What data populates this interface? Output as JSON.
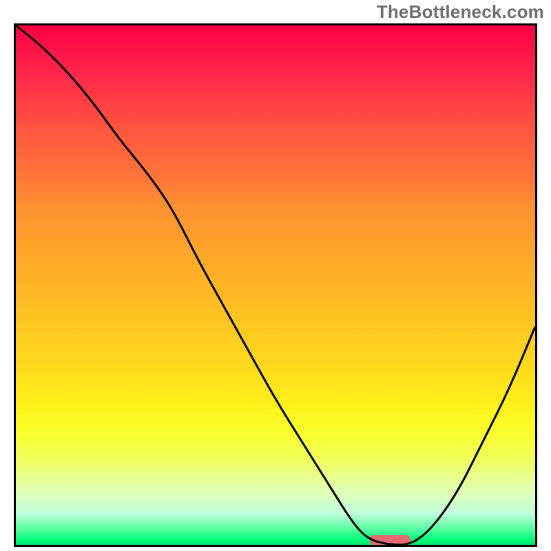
{
  "watermark": "TheBottleneck.com",
  "chart_data": {
    "type": "line",
    "title": "",
    "xlabel": "",
    "ylabel": "",
    "xlim": [
      0,
      100
    ],
    "ylim": [
      0,
      100
    ],
    "series": [
      {
        "name": "curve",
        "x": [
          0,
          5,
          10,
          15,
          20,
          25,
          30,
          35,
          40,
          45,
          50,
          55,
          60,
          65,
          68,
          72,
          76,
          80,
          85,
          90,
          95,
          100
        ],
        "y": [
          100,
          96,
          91,
          85,
          78,
          72,
          65,
          55,
          46,
          37,
          28,
          20,
          12,
          4,
          1,
          0,
          0,
          3,
          10,
          20,
          30,
          42
        ]
      }
    ],
    "marker": {
      "x_start": 68,
      "x_end": 76,
      "y": 0
    },
    "gradient": {
      "orientation": "vertical",
      "stops": [
        {
          "pos": 0.0,
          "color": "#ff0044"
        },
        {
          "pos": 0.35,
          "color": "#ff9230"
        },
        {
          "pos": 0.65,
          "color": "#ffd81e"
        },
        {
          "pos": 0.9,
          "color": "#e0ffb9"
        },
        {
          "pos": 1.0,
          "color": "#00e56d"
        }
      ]
    }
  }
}
